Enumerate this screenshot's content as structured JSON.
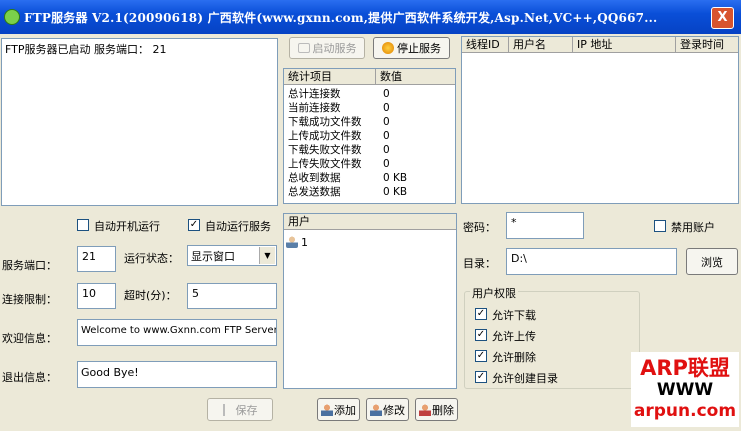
{
  "window": {
    "title": "FTP服务器 V2.1(20090618)  广西软件(www.gxnn.com,提供广西软件系统开发,Asp.Net,VC++,QQ667...",
    "close_label": "X"
  },
  "log": {
    "text": "FTP服务器已启动 服务端口： 21"
  },
  "toolbar": {
    "start_label": "启动服务",
    "stop_label": "停止服务"
  },
  "stats": {
    "headers": [
      "统计项目",
      "数值"
    ],
    "rows": [
      {
        "label": "总计连接数",
        "value": "0"
      },
      {
        "label": "当前连接数",
        "value": "0"
      },
      {
        "label": "下载成功文件数",
        "value": "0"
      },
      {
        "label": "上传成功文件数",
        "value": "0"
      },
      {
        "label": "下载失败文件数",
        "value": "0"
      },
      {
        "label": "上传失败文件数",
        "value": "0"
      },
      {
        "label": "总收到数据",
        "value": "0 KB"
      },
      {
        "label": "总发送数据",
        "value": "0 KB"
      }
    ]
  },
  "connections": {
    "headers": [
      "线程ID",
      "用户名",
      "IP 地址",
      "登录时间"
    ]
  },
  "settings": {
    "auto_boot_label": "自动开机运行",
    "auto_run_label": "自动运行服务",
    "port_label": "服务端口：",
    "port_value": "21",
    "run_state_label": "运行状态：",
    "run_state_value": "显示窗口",
    "conn_limit_label": "连接限制：",
    "conn_limit_value": "10",
    "timeout_label": "超时(分)：",
    "timeout_value": "5",
    "welcome_label": "欢迎信息：",
    "welcome_value": "Welcome to www.Gxnn.com FTP Server!",
    "exit_label": "退出信息：",
    "exit_value": "Good Bye!",
    "save_label": "保存"
  },
  "users": {
    "header": "用户",
    "items": [
      "1"
    ],
    "add_label": "添加",
    "edit_label": "修改",
    "delete_label": "删除"
  },
  "account": {
    "password_label": "密码：",
    "password_value": "*",
    "disable_label": "禁用账户",
    "dir_label": "目录：",
    "dir_value": "D:\\",
    "browse_label": "浏览",
    "perm_title": "用户权限",
    "perms": [
      "允许下载",
      "允许上传",
      "允许删除",
      "允许创建目录"
    ]
  },
  "watermark": {
    "line1": "ARP联盟",
    "line2": "WWW",
    "line3": "arpun.com"
  },
  "colors": {
    "titlebar": "#0a4fd8",
    "watermark": "#e01010"
  }
}
